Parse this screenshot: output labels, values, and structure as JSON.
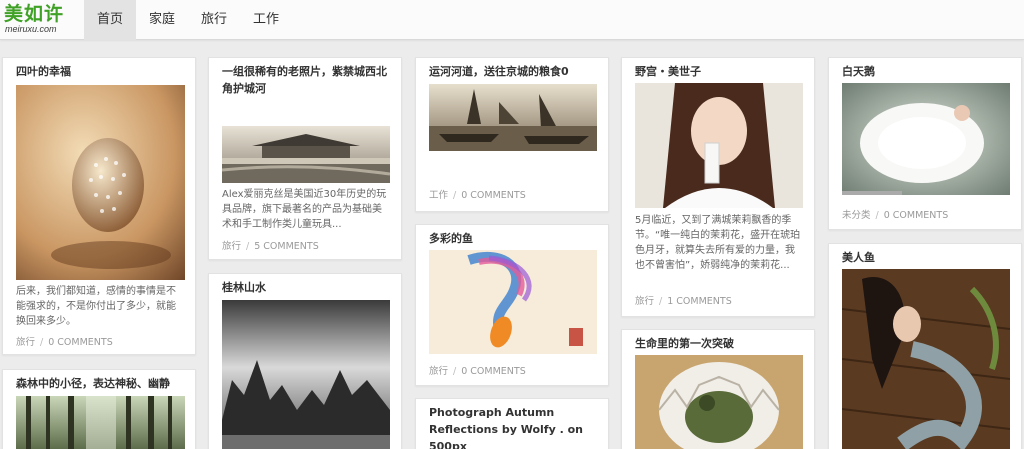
{
  "brand": {
    "name_cn": "美如许",
    "domain": "meiruxu.com",
    "accent": "#3fa125"
  },
  "nav": {
    "items": [
      {
        "label": "首页",
        "active": true
      },
      {
        "label": "家庭",
        "active": false
      },
      {
        "label": "旅行",
        "active": false
      },
      {
        "label": "工作",
        "active": false
      }
    ]
  },
  "posts": {
    "p1": {
      "title": "四叶的幸福",
      "excerpt": "后来，我们都知道，感情的事情是不能强求的，不是你付出了多少，就能换回来多少。",
      "category": "旅行",
      "comments": "0 COMMENTS",
      "image": "carved-egg-photo"
    },
    "p2": {
      "title": "森林中的小径，表达神秘、幽静",
      "image": "forest-path-photo"
    },
    "p3": {
      "title": "一组很稀有的老照片，紫禁城西北角护城河",
      "excerpt": "Alex爱丽克丝是美国近30年历史的玩具品牌，旗下最著名的产品为基础美术和手工制作类儿童玩具...",
      "category": "旅行",
      "comments": "5 COMMENTS",
      "image": "forbidden-city-photo"
    },
    "p4": {
      "title": "桂林山水",
      "image": "guilin-landscape-photo"
    },
    "p5": {
      "title": "运河河道，送往京城的粮食0",
      "category": "工作",
      "comments": "0 COMMENTS",
      "image": "canal-boats-photo"
    },
    "p6": {
      "title": "多彩的鱼",
      "category": "旅行",
      "comments": "0 COMMENTS",
      "image": "colorful-fish-painting"
    },
    "p7": {
      "title": "Photograph Autumn Reflections by Wolfy . on 500px"
    },
    "p8": {
      "title": "野宫・美世子",
      "excerpt": "5月临近，又到了满城茉莉飘香的季节。“唯一纯白的茉莉花，盛开在琥珀色月牙，就算失去所有爱的力量，我也不曾害怕”，娇弱纯净的茉莉花...",
      "category": "旅行",
      "comments": "1 COMMENTS",
      "image": "girl-portrait-photo"
    },
    "p9": {
      "title": "生命里的第一次突破",
      "image": "hatching-turtle-photo"
    },
    "p10": {
      "title": "白天鹅",
      "category": "未分类",
      "comments": "0 COMMENTS",
      "image": "white-dress-photo"
    },
    "p11": {
      "title": "美人鱼",
      "image": "mermaid-painting"
    }
  }
}
